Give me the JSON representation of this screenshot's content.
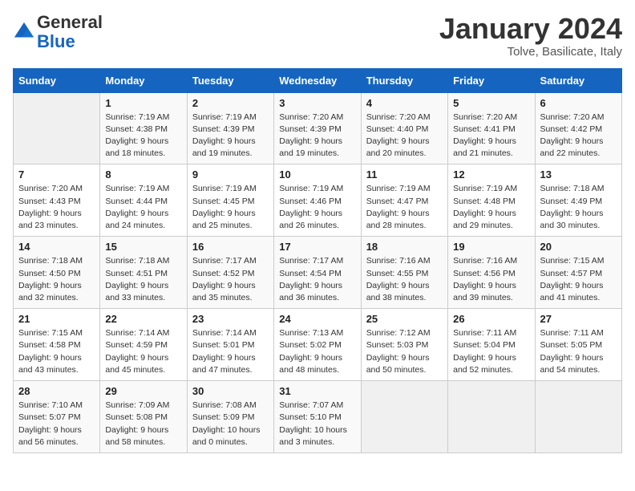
{
  "header": {
    "logo_general": "General",
    "logo_blue": "Blue",
    "month_title": "January 2024",
    "subtitle": "Tolve, Basilicate, Italy"
  },
  "weekdays": [
    "Sunday",
    "Monday",
    "Tuesday",
    "Wednesday",
    "Thursday",
    "Friday",
    "Saturday"
  ],
  "weeks": [
    [
      {
        "day": "",
        "sunrise": "",
        "sunset": "",
        "daylight": ""
      },
      {
        "day": "1",
        "sunrise": "Sunrise: 7:19 AM",
        "sunset": "Sunset: 4:38 PM",
        "daylight": "Daylight: 9 hours and 18 minutes."
      },
      {
        "day": "2",
        "sunrise": "Sunrise: 7:19 AM",
        "sunset": "Sunset: 4:39 PM",
        "daylight": "Daylight: 9 hours and 19 minutes."
      },
      {
        "day": "3",
        "sunrise": "Sunrise: 7:20 AM",
        "sunset": "Sunset: 4:39 PM",
        "daylight": "Daylight: 9 hours and 19 minutes."
      },
      {
        "day": "4",
        "sunrise": "Sunrise: 7:20 AM",
        "sunset": "Sunset: 4:40 PM",
        "daylight": "Daylight: 9 hours and 20 minutes."
      },
      {
        "day": "5",
        "sunrise": "Sunrise: 7:20 AM",
        "sunset": "Sunset: 4:41 PM",
        "daylight": "Daylight: 9 hours and 21 minutes."
      },
      {
        "day": "6",
        "sunrise": "Sunrise: 7:20 AM",
        "sunset": "Sunset: 4:42 PM",
        "daylight": "Daylight: 9 hours and 22 minutes."
      }
    ],
    [
      {
        "day": "7",
        "sunrise": "Sunrise: 7:20 AM",
        "sunset": "Sunset: 4:43 PM",
        "daylight": "Daylight: 9 hours and 23 minutes."
      },
      {
        "day": "8",
        "sunrise": "Sunrise: 7:19 AM",
        "sunset": "Sunset: 4:44 PM",
        "daylight": "Daylight: 9 hours and 24 minutes."
      },
      {
        "day": "9",
        "sunrise": "Sunrise: 7:19 AM",
        "sunset": "Sunset: 4:45 PM",
        "daylight": "Daylight: 9 hours and 25 minutes."
      },
      {
        "day": "10",
        "sunrise": "Sunrise: 7:19 AM",
        "sunset": "Sunset: 4:46 PM",
        "daylight": "Daylight: 9 hours and 26 minutes."
      },
      {
        "day": "11",
        "sunrise": "Sunrise: 7:19 AM",
        "sunset": "Sunset: 4:47 PM",
        "daylight": "Daylight: 9 hours and 28 minutes."
      },
      {
        "day": "12",
        "sunrise": "Sunrise: 7:19 AM",
        "sunset": "Sunset: 4:48 PM",
        "daylight": "Daylight: 9 hours and 29 minutes."
      },
      {
        "day": "13",
        "sunrise": "Sunrise: 7:18 AM",
        "sunset": "Sunset: 4:49 PM",
        "daylight": "Daylight: 9 hours and 30 minutes."
      }
    ],
    [
      {
        "day": "14",
        "sunrise": "Sunrise: 7:18 AM",
        "sunset": "Sunset: 4:50 PM",
        "daylight": "Daylight: 9 hours and 32 minutes."
      },
      {
        "day": "15",
        "sunrise": "Sunrise: 7:18 AM",
        "sunset": "Sunset: 4:51 PM",
        "daylight": "Daylight: 9 hours and 33 minutes."
      },
      {
        "day": "16",
        "sunrise": "Sunrise: 7:17 AM",
        "sunset": "Sunset: 4:52 PM",
        "daylight": "Daylight: 9 hours and 35 minutes."
      },
      {
        "day": "17",
        "sunrise": "Sunrise: 7:17 AM",
        "sunset": "Sunset: 4:54 PM",
        "daylight": "Daylight: 9 hours and 36 minutes."
      },
      {
        "day": "18",
        "sunrise": "Sunrise: 7:16 AM",
        "sunset": "Sunset: 4:55 PM",
        "daylight": "Daylight: 9 hours and 38 minutes."
      },
      {
        "day": "19",
        "sunrise": "Sunrise: 7:16 AM",
        "sunset": "Sunset: 4:56 PM",
        "daylight": "Daylight: 9 hours and 39 minutes."
      },
      {
        "day": "20",
        "sunrise": "Sunrise: 7:15 AM",
        "sunset": "Sunset: 4:57 PM",
        "daylight": "Daylight: 9 hours and 41 minutes."
      }
    ],
    [
      {
        "day": "21",
        "sunrise": "Sunrise: 7:15 AM",
        "sunset": "Sunset: 4:58 PM",
        "daylight": "Daylight: 9 hours and 43 minutes."
      },
      {
        "day": "22",
        "sunrise": "Sunrise: 7:14 AM",
        "sunset": "Sunset: 4:59 PM",
        "daylight": "Daylight: 9 hours and 45 minutes."
      },
      {
        "day": "23",
        "sunrise": "Sunrise: 7:14 AM",
        "sunset": "Sunset: 5:01 PM",
        "daylight": "Daylight: 9 hours and 47 minutes."
      },
      {
        "day": "24",
        "sunrise": "Sunrise: 7:13 AM",
        "sunset": "Sunset: 5:02 PM",
        "daylight": "Daylight: 9 hours and 48 minutes."
      },
      {
        "day": "25",
        "sunrise": "Sunrise: 7:12 AM",
        "sunset": "Sunset: 5:03 PM",
        "daylight": "Daylight: 9 hours and 50 minutes."
      },
      {
        "day": "26",
        "sunrise": "Sunrise: 7:11 AM",
        "sunset": "Sunset: 5:04 PM",
        "daylight": "Daylight: 9 hours and 52 minutes."
      },
      {
        "day": "27",
        "sunrise": "Sunrise: 7:11 AM",
        "sunset": "Sunset: 5:05 PM",
        "daylight": "Daylight: 9 hours and 54 minutes."
      }
    ],
    [
      {
        "day": "28",
        "sunrise": "Sunrise: 7:10 AM",
        "sunset": "Sunset: 5:07 PM",
        "daylight": "Daylight: 9 hours and 56 minutes."
      },
      {
        "day": "29",
        "sunrise": "Sunrise: 7:09 AM",
        "sunset": "Sunset: 5:08 PM",
        "daylight": "Daylight: 9 hours and 58 minutes."
      },
      {
        "day": "30",
        "sunrise": "Sunrise: 7:08 AM",
        "sunset": "Sunset: 5:09 PM",
        "daylight": "Daylight: 10 hours and 0 minutes."
      },
      {
        "day": "31",
        "sunrise": "Sunrise: 7:07 AM",
        "sunset": "Sunset: 5:10 PM",
        "daylight": "Daylight: 10 hours and 3 minutes."
      },
      {
        "day": "",
        "sunrise": "",
        "sunset": "",
        "daylight": ""
      },
      {
        "day": "",
        "sunrise": "",
        "sunset": "",
        "daylight": ""
      },
      {
        "day": "",
        "sunrise": "",
        "sunset": "",
        "daylight": ""
      }
    ]
  ]
}
